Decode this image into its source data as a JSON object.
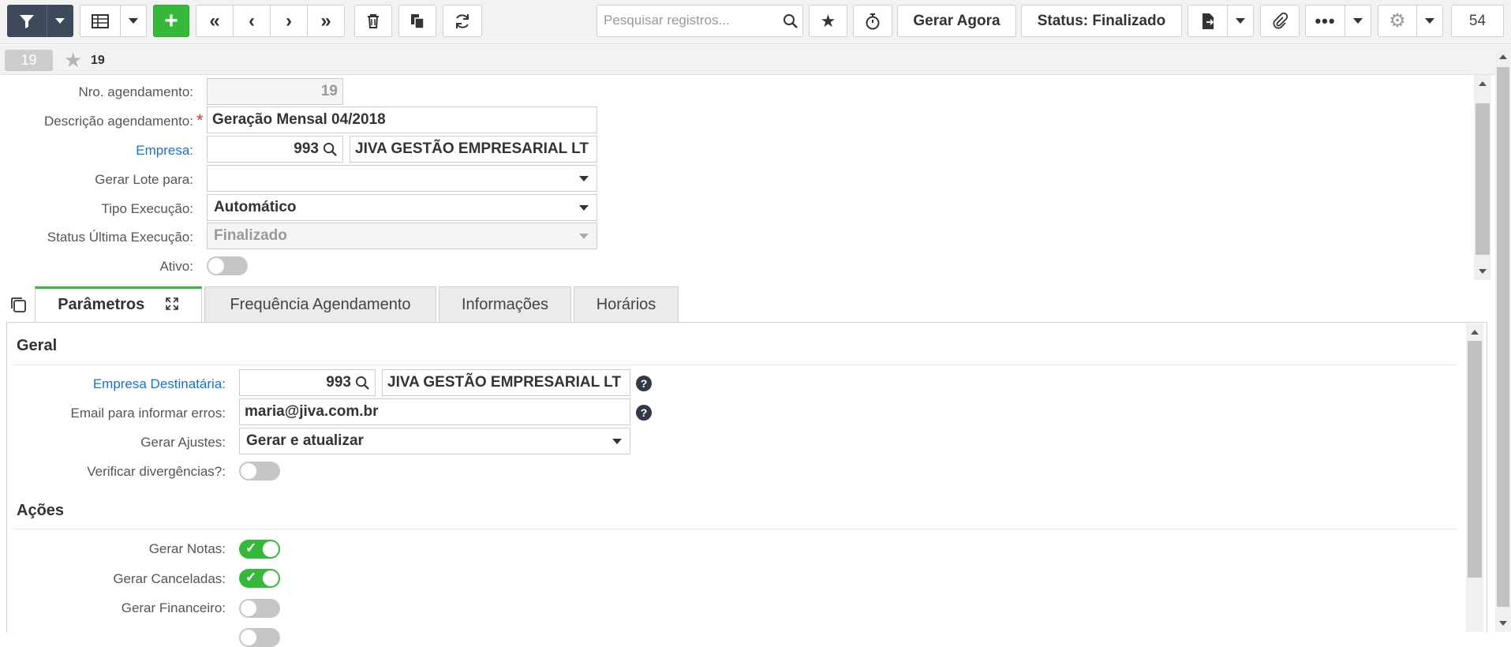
{
  "toolbar": {
    "search_placeholder": "Pesquisar registros...",
    "gerar_agora": "Gerar Agora",
    "status": "Status: Finalizado",
    "count": "54"
  },
  "record": {
    "badge": "19",
    "fav_label": "19"
  },
  "form": {
    "nro_label": "Nro. agendamento:",
    "nro_value": "19",
    "descricao_label": "Descrição agendamento:",
    "required_mark": "*",
    "descricao_value": "Geração Mensal 04/2018",
    "empresa_label": "Empresa:",
    "empresa_code": "993",
    "empresa_name": "JIVA GESTÃO EMPRESARIAL LT",
    "gerar_lote_label": "Gerar Lote para:",
    "gerar_lote_value": "",
    "tipo_label": "Tipo Execução:",
    "tipo_value": "Automático",
    "status_label": "Status Última Execução:",
    "status_value": "Finalizado",
    "ativo_label": "Ativo:",
    "ativo_on": false
  },
  "tabs": [
    {
      "label": "Parâmetros",
      "active": true
    },
    {
      "label": "Frequência Agendamento",
      "active": false
    },
    {
      "label": "Informações",
      "active": false
    },
    {
      "label": "Horários",
      "active": false
    }
  ],
  "params": {
    "geral_title": "Geral",
    "empresa_dest_label": "Empresa Destinatária:",
    "empresa_dest_code": "993",
    "empresa_dest_name": "JIVA GESTÃO EMPRESARIAL LT",
    "email_label": "Email para informar erros:",
    "email_value": "maria@jiva.com.br",
    "ajustes_label": "Gerar Ajustes:",
    "ajustes_value": "Gerar e atualizar",
    "divergencias_label": "Verificar divergências?:",
    "acoes_title": "Ações",
    "notas_label": "Gerar Notas:",
    "canceladas_label": "Gerar Canceladas:",
    "financeiro_label": "Gerar Financeiro:"
  },
  "colors": {
    "accent_green": "#36b93b",
    "toolbar_dark": "#3d4a5c",
    "link_blue": "#1a73c8"
  }
}
